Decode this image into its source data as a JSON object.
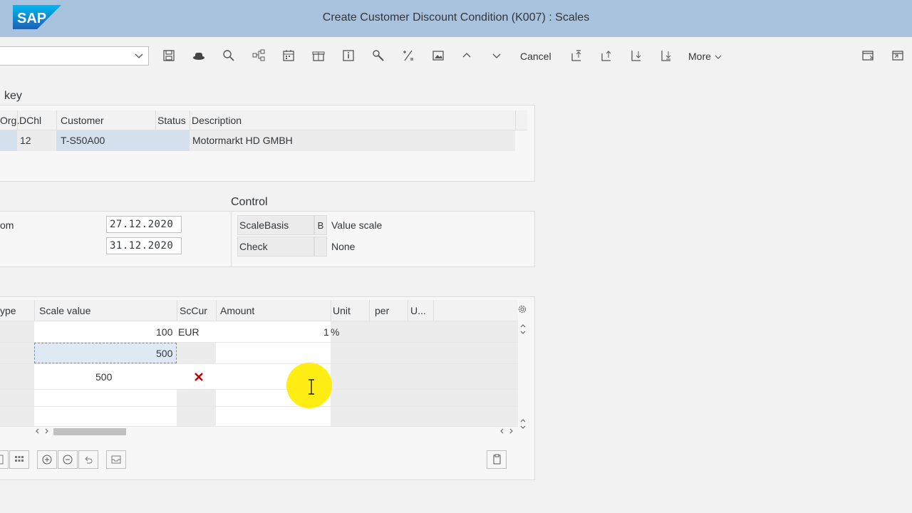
{
  "header": {
    "logo_text": "SAP",
    "title": "Create Customer Discount Condition (K007) : Scales"
  },
  "toolbar": {
    "select_value": "",
    "cancel_label": "Cancel",
    "more_label": "More"
  },
  "key_section": {
    "title": "key",
    "columns": [
      "Org.",
      "DChl",
      "Customer",
      "Status",
      "Description"
    ],
    "row": {
      "dchl": "12",
      "customer": "T-S50A00",
      "status": "",
      "description": "Motormarkt HD GMBH"
    }
  },
  "validity": {
    "from_label": "om",
    "from_value": "27.12.2020",
    "to_value": "31.12.2020"
  },
  "control": {
    "title": "Control",
    "scale_basis_label": "ScaleBasis",
    "scale_basis_value": "B",
    "scale_basis_text": "Value scale",
    "check_label": "Check",
    "check_value": "",
    "check_text": "None"
  },
  "scales": {
    "columns": [
      "ype",
      "Scale value",
      "ScCur",
      "Amount",
      "Unit",
      "per",
      "U..."
    ],
    "rows": [
      {
        "scale_value": "100",
        "sccur": "EUR",
        "amount": "1",
        "unit": "%"
      },
      {
        "scale_value": "500",
        "sccur": "",
        "amount": "",
        "unit": ""
      }
    ],
    "suggestion": {
      "value": "500"
    }
  },
  "colors": {
    "header_bg": "#a9c3de",
    "logo_blue": "#1e88e5",
    "selection": "#d4e0ee",
    "delete_red": "#c00000",
    "cursor_highlight": "#ffeb00"
  }
}
